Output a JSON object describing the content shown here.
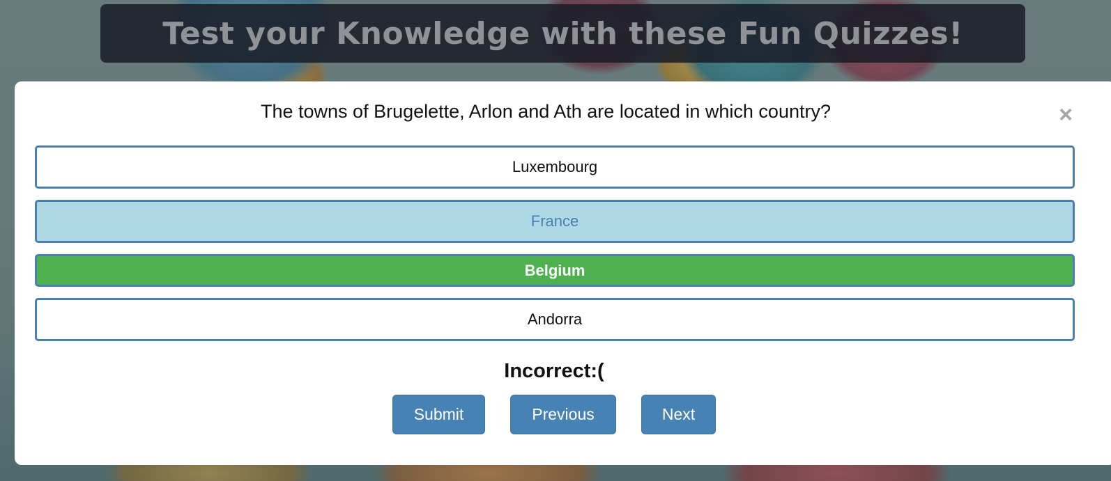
{
  "header": {
    "title": "Test your Knowledge with these Fun Quizzes!"
  },
  "quiz": {
    "question": "The towns of Brugelette, Arlon and Ath are located in which country?",
    "close_icon": "close-icon",
    "close_glyph": "×",
    "answers": [
      {
        "label": "Luxembourg",
        "state": "default"
      },
      {
        "label": "France",
        "state": "selected"
      },
      {
        "label": "Belgium",
        "state": "correct"
      },
      {
        "label": "Andorra",
        "state": "default"
      }
    ],
    "result": "Incorrect:(",
    "buttons": {
      "submit": "Submit",
      "previous": "Previous",
      "next": "Next"
    }
  },
  "colors": {
    "accent": "#4682b4",
    "selected_bg": "#add8e6",
    "correct_bg": "#4db14f",
    "title_bar_bg": "#1a1e28"
  }
}
